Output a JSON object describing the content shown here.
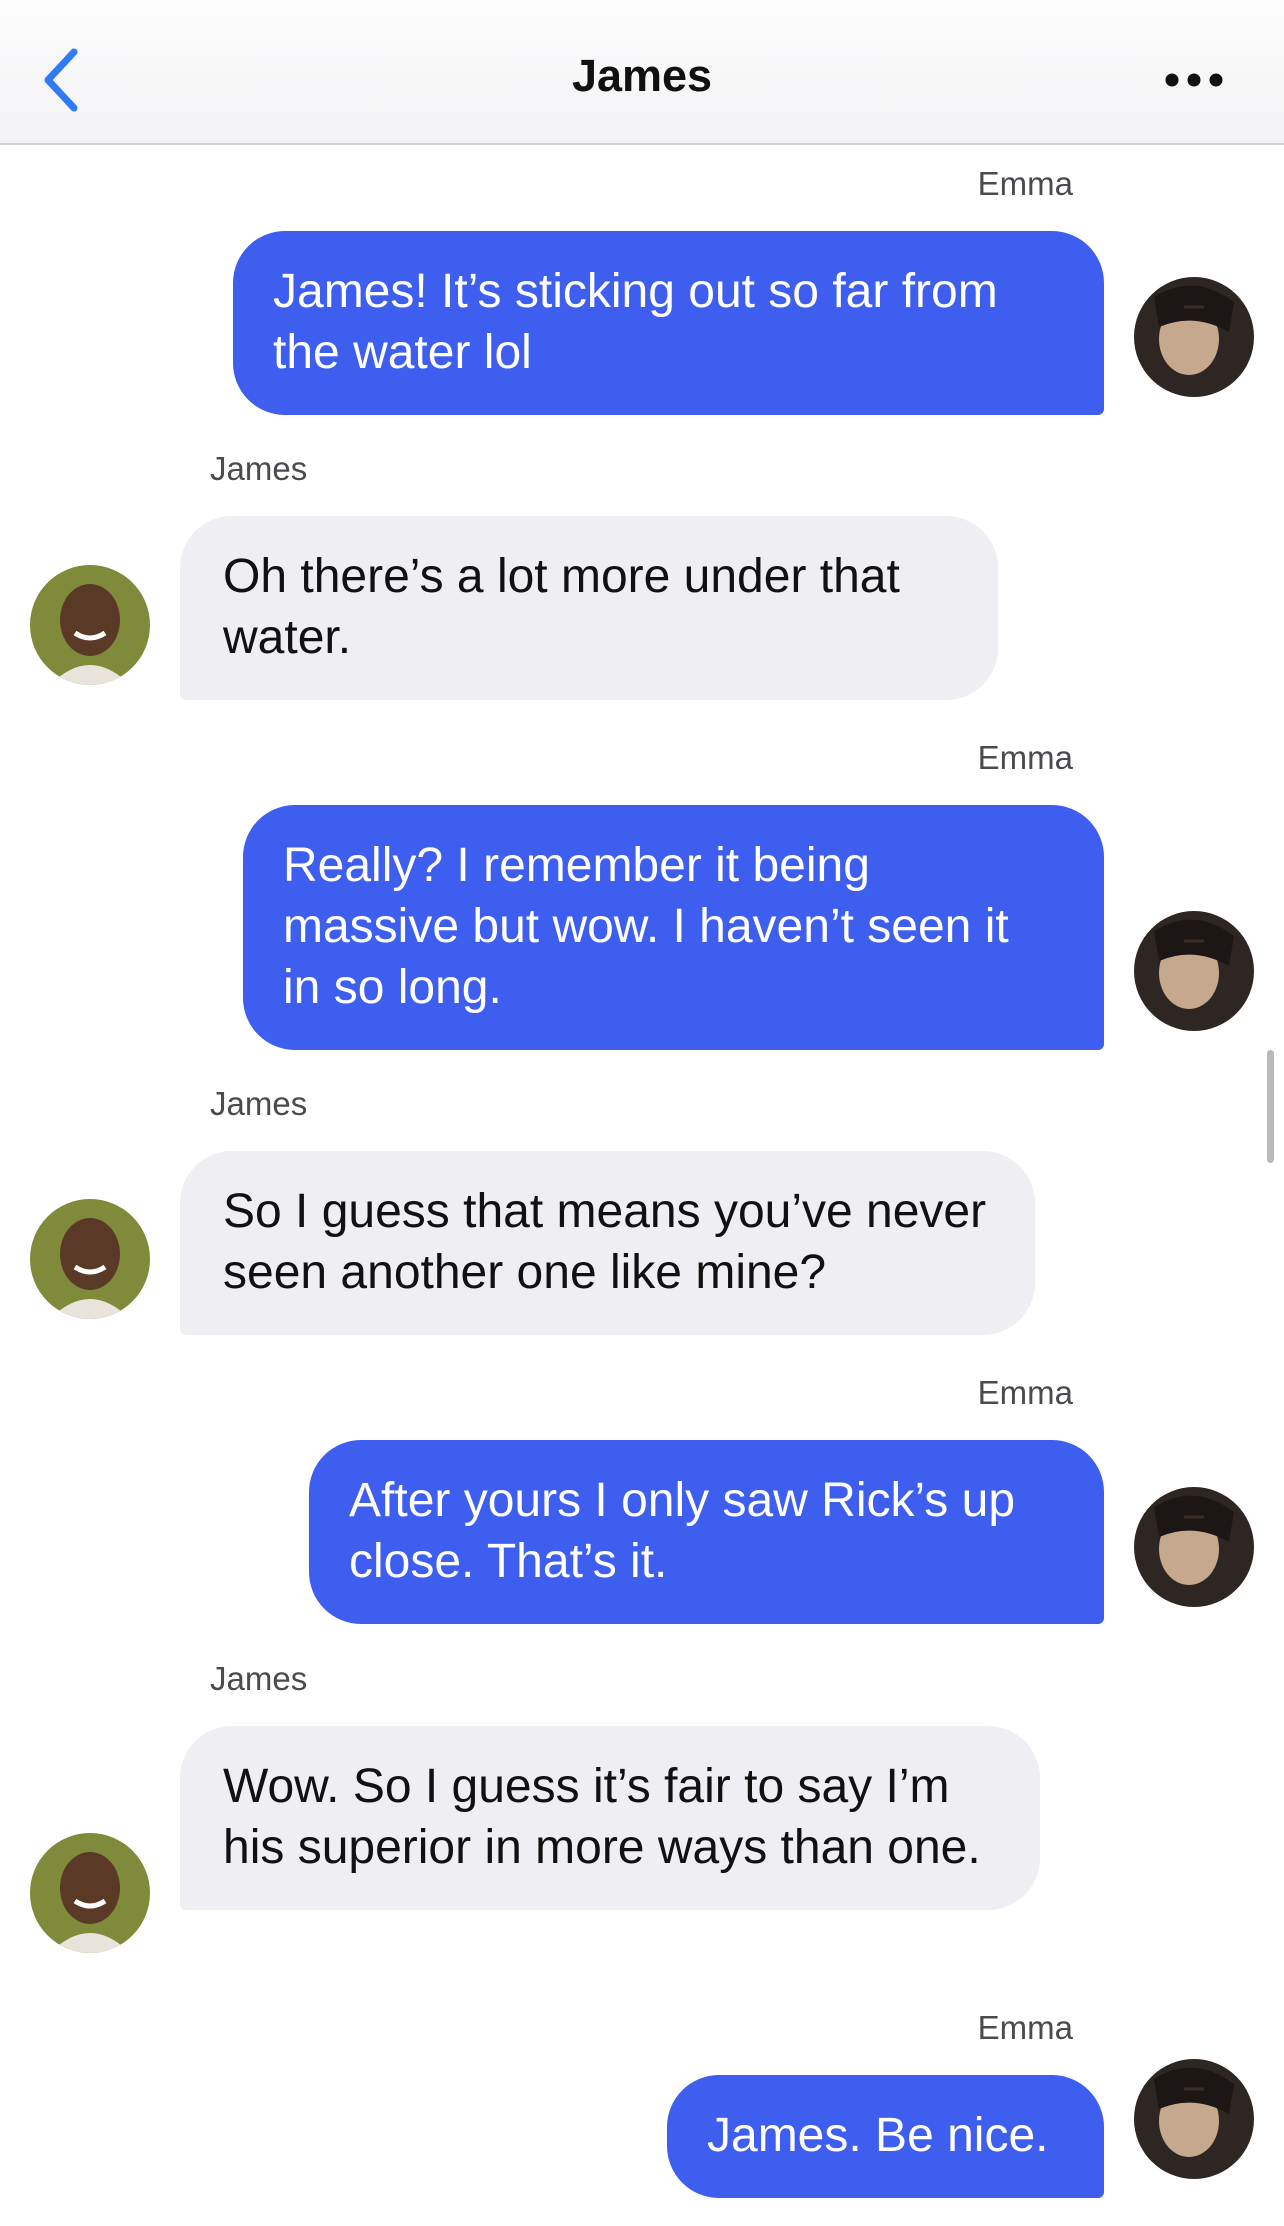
{
  "header": {
    "title": "James",
    "back_icon": "chevron-left-icon",
    "more_icon": "ellipsis-icon"
  },
  "colors": {
    "outgoing_bubble": "#3e5ef0",
    "incoming_bubble": "#eeeef3",
    "accent": "#2f7bf5"
  },
  "messages": [
    {
      "sender": "Emma",
      "text": "James! It’s sticking out so far from the water lol",
      "direction": "outgoing"
    },
    {
      "sender": "James",
      "text": "Oh there’s a lot more under that water.",
      "direction": "incoming"
    },
    {
      "sender": "Emma",
      "text": "Really? I remember it being massive but wow. I haven’t seen it in so long.",
      "direction": "outgoing"
    },
    {
      "sender": "James",
      "text": "So I guess that means you’ve never seen another one like mine?",
      "direction": "incoming"
    },
    {
      "sender": "Emma",
      "text": "After yours I only saw Rick’s up close. That’s it.",
      "direction": "outgoing"
    },
    {
      "sender": "James",
      "text": "Wow. So I guess it’s fair to say I’m his superior in more ways than one.",
      "direction": "incoming"
    },
    {
      "sender": "Emma",
      "text": "James. Be nice.",
      "direction": "outgoing"
    }
  ]
}
